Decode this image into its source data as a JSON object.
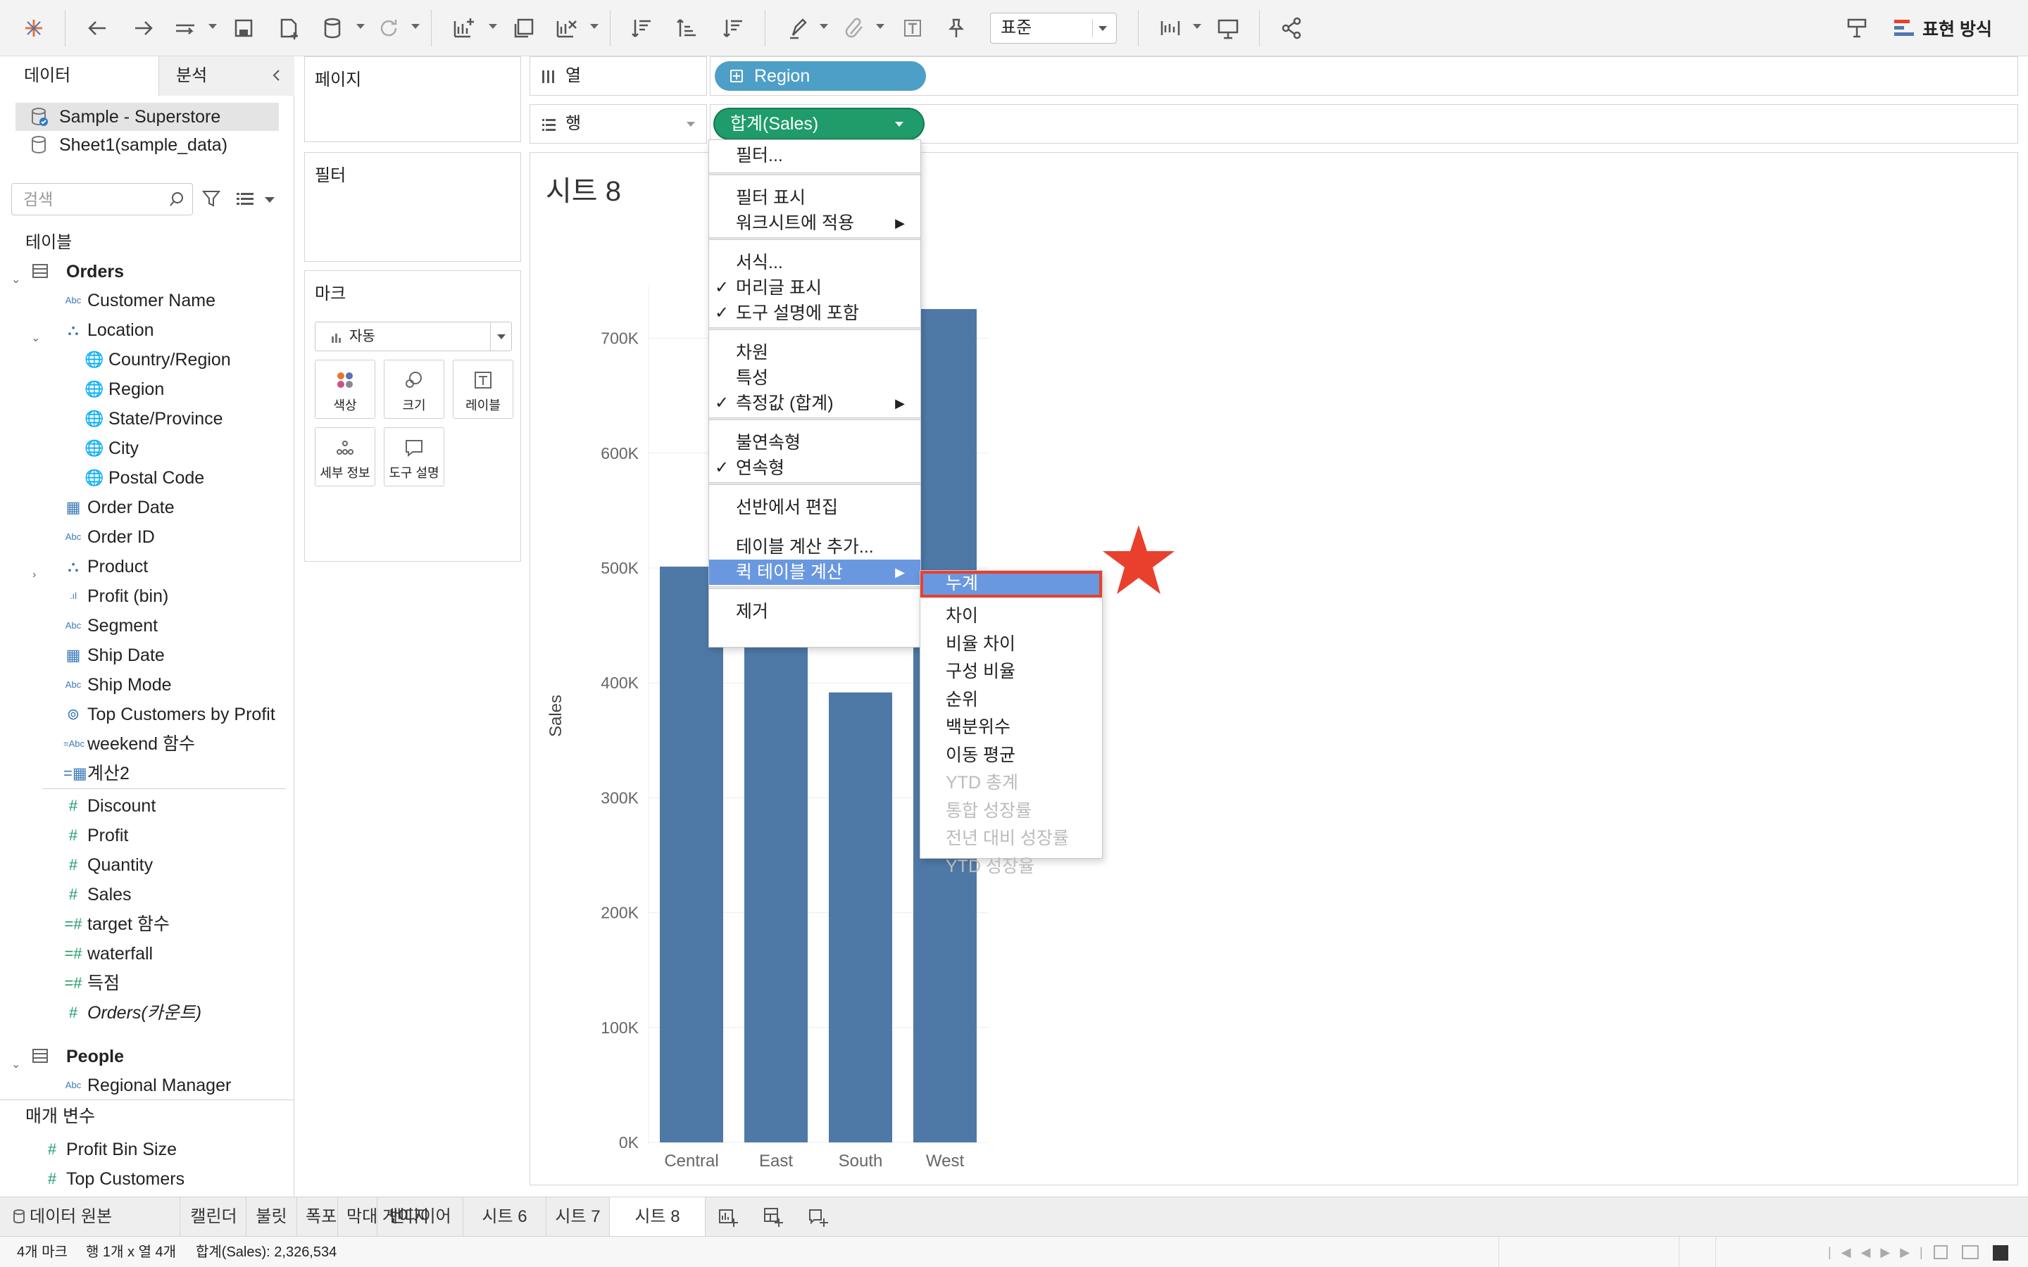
{
  "toolbar": {
    "font_style": "표준",
    "show_me": "표현 방식"
  },
  "data_pane": {
    "tab_data": "데이터",
    "tab_analysis": "분석",
    "datasources": [
      "Sample - Superstore",
      "Sheet1(sample_data)"
    ],
    "search_placeholder": "검색",
    "tables_label": "테이블",
    "orders_table": "Orders",
    "fields": [
      {
        "name": "Customer Name",
        "type": "Abc"
      },
      {
        "name": "Location",
        "type": "hierarchy"
      },
      {
        "name": "Country/Region",
        "type": "geo"
      },
      {
        "name": "Region",
        "type": "geo"
      },
      {
        "name": "State/Province",
        "type": "geo"
      },
      {
        "name": "City",
        "type": "geo"
      },
      {
        "name": "Postal Code",
        "type": "geo"
      },
      {
        "name": "Order Date",
        "type": "date"
      },
      {
        "name": "Order ID",
        "type": "Abc"
      },
      {
        "name": "Product",
        "type": "hierarchy"
      },
      {
        "name": "Profit (bin)",
        "type": "bin"
      },
      {
        "name": "Segment",
        "type": "Abc"
      },
      {
        "name": "Ship Date",
        "type": "date"
      },
      {
        "name": "Ship Mode",
        "type": "Abc"
      },
      {
        "name": "Top Customers by Profit",
        "type": "set"
      },
      {
        "name": "weekend 함수",
        "type": "calc-abc"
      },
      {
        "name": "계산2",
        "type": "calc-date"
      }
    ],
    "measures": [
      {
        "name": "Discount",
        "type": "#"
      },
      {
        "name": "Profit",
        "type": "#"
      },
      {
        "name": "Quantity",
        "type": "#"
      },
      {
        "name": "Sales",
        "type": "#"
      },
      {
        "name": "target 함수",
        "type": "calc-#"
      },
      {
        "name": "waterfall",
        "type": "calc-#"
      },
      {
        "name": "득점",
        "type": "calc-#"
      },
      {
        "name": "Orders(카운트)",
        "type": "#"
      }
    ],
    "people_table": "People",
    "people_fields": [
      {
        "name": "Regional Manager",
        "type": "Abc"
      }
    ],
    "params_label": "매개 변수",
    "params": [
      {
        "name": "Profit Bin Size"
      },
      {
        "name": "Top Customers"
      }
    ]
  },
  "cards": {
    "pages": "페이지",
    "filters": "필터",
    "marks": "마크",
    "mark_type": "자동",
    "mark_buttons": [
      "색상",
      "크기",
      "레이블",
      "세부 정보",
      "도구 설명"
    ]
  },
  "shelves": {
    "columns_label": "열",
    "rows_label": "행",
    "column_pill": "Region",
    "row_pill": "합계(Sales)"
  },
  "sheet": {
    "title": "시트 8"
  },
  "context_menu": {
    "items": [
      {
        "label": "필터...",
        "check": false,
        "arrow": false
      },
      {
        "label": "필터 표시",
        "check": false,
        "arrow": false
      },
      {
        "label": "워크시트에 적용",
        "check": false,
        "arrow": true
      },
      {
        "label": "서식...",
        "check": false,
        "arrow": false
      },
      {
        "label": "머리글 표시",
        "check": true,
        "arrow": false
      },
      {
        "label": "도구 설명에 포함",
        "check": true,
        "arrow": false
      },
      {
        "label": "차원",
        "check": false,
        "arrow": false
      },
      {
        "label": "특성",
        "check": false,
        "arrow": false
      },
      {
        "label": "측정값 (합계)",
        "check": true,
        "arrow": true
      },
      {
        "label": "불연속형",
        "check": false,
        "arrow": false
      },
      {
        "label": "연속형",
        "check": true,
        "arrow": false
      },
      {
        "label": "선반에서 편집",
        "check": false,
        "arrow": false
      },
      {
        "label": "테이블 계산 추가...",
        "check": false,
        "arrow": false
      },
      {
        "label": "퀵 테이블 계산",
        "check": false,
        "arrow": true,
        "highlighted": true
      },
      {
        "label": "제거",
        "check": false,
        "arrow": false
      }
    ],
    "check_mark": "✓",
    "arrow_mark": "▶"
  },
  "submenu": {
    "items": [
      {
        "label": "누계",
        "enabled": true,
        "highlighted": true
      },
      {
        "label": "차이",
        "enabled": true
      },
      {
        "label": "비율 차이",
        "enabled": true
      },
      {
        "label": "구성 비율",
        "enabled": true
      },
      {
        "label": "순위",
        "enabled": true
      },
      {
        "label": "백분위수",
        "enabled": true
      },
      {
        "label": "이동 평균",
        "enabled": true
      },
      {
        "label": "YTD 총계",
        "enabled": false
      },
      {
        "label": "통합 성장률",
        "enabled": false
      },
      {
        "label": "전년 대비 성장률",
        "enabled": false
      },
      {
        "label": "YTD 성장율",
        "enabled": false
      }
    ]
  },
  "chart_data": {
    "type": "bar",
    "categories": [
      "Central",
      "East",
      "South",
      "West"
    ],
    "values": [
      501240,
      678781,
      391722,
      725458
    ],
    "ylabel": "Sales",
    "xlabel": "",
    "yticks": [
      "0K",
      "100K",
      "200K",
      "300K",
      "400K",
      "500K",
      "600K",
      "700K"
    ],
    "ylim": [
      0,
      760000
    ],
    "bar_color": "#4e79a7",
    "grid": true
  },
  "tabs": {
    "datasource": "데이터 원본",
    "sheets": [
      "캘린더",
      "불릿",
      "폭포",
      "막대 게이지",
      "벤다이어",
      "시트 6",
      "시트 7",
      "시트 8"
    ],
    "active": "시트 8"
  },
  "status": {
    "marks": "4개 마크",
    "dims": "행 1개 x 열 4개",
    "sum": "합계(Sales): 2,326,534"
  },
  "colors": {
    "accent_highlight": "#6a98e0",
    "annotation": "#e8402c",
    "dim_pill": "#4e9fc7",
    "measure_pill": "#1f9c6a"
  }
}
